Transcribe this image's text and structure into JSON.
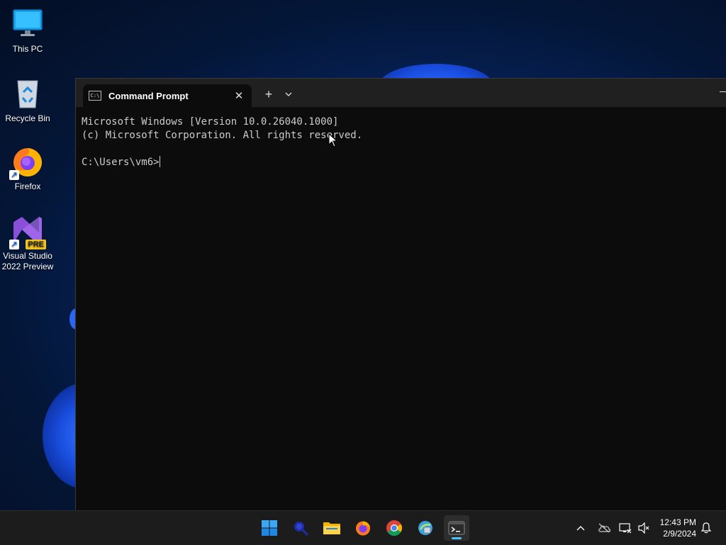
{
  "desktop": {
    "icons": [
      {
        "label": "This PC",
        "icon": "monitor-icon"
      },
      {
        "label": "Recycle Bin",
        "icon": "recycle-bin-icon"
      },
      {
        "label": "Firefox",
        "icon": "firefox-icon"
      },
      {
        "label": "Visual Studio 2022 Preview",
        "label_line1": "Visual Studio",
        "label_line2": "2022 Preview",
        "badge": "PRE",
        "icon": "visual-studio-icon"
      }
    ]
  },
  "terminal": {
    "tab_title": "Command Prompt",
    "tab_icon_text": "C:\\",
    "new_tab_symbol": "+",
    "lines": [
      "Microsoft Windows [Version 10.0.26040.1000]",
      "(c) Microsoft Corporation. All rights reserved.",
      "",
      "C:\\Users\\vm6>"
    ]
  },
  "taskbar": {
    "apps": [
      "start-icon",
      "search-icon",
      "file-explorer-icon",
      "firefox-icon",
      "chrome-icon",
      "control-panel-icon",
      "terminal-icon"
    ],
    "active_app": "terminal-icon",
    "tray": [
      "chevron-up-icon",
      "onedrive-offline-icon",
      "network-icon",
      "volume-muted-icon"
    ],
    "time": "12:43 PM",
    "date": "2/9/2024",
    "notification_icon": "bell-icon"
  },
  "colors": {
    "accent": "#4cc2ff",
    "terminal_bg": "#0c0c0c",
    "terminal_text": "#cccccc",
    "taskbar_bg": "#1c1c1c"
  }
}
